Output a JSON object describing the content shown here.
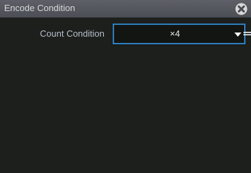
{
  "dialog": {
    "title": "Encode Condition",
    "close_icon": "close-circle-x-icon"
  },
  "count_condition": {
    "label": "Count Condition",
    "value": "×4",
    "dropdown_icon": "chevron-down-icon"
  },
  "colors": {
    "background": "#1c1f1c",
    "titlebar": "#55585e",
    "select_border": "#2d7fc0",
    "label_text": "#b8bfcb"
  }
}
